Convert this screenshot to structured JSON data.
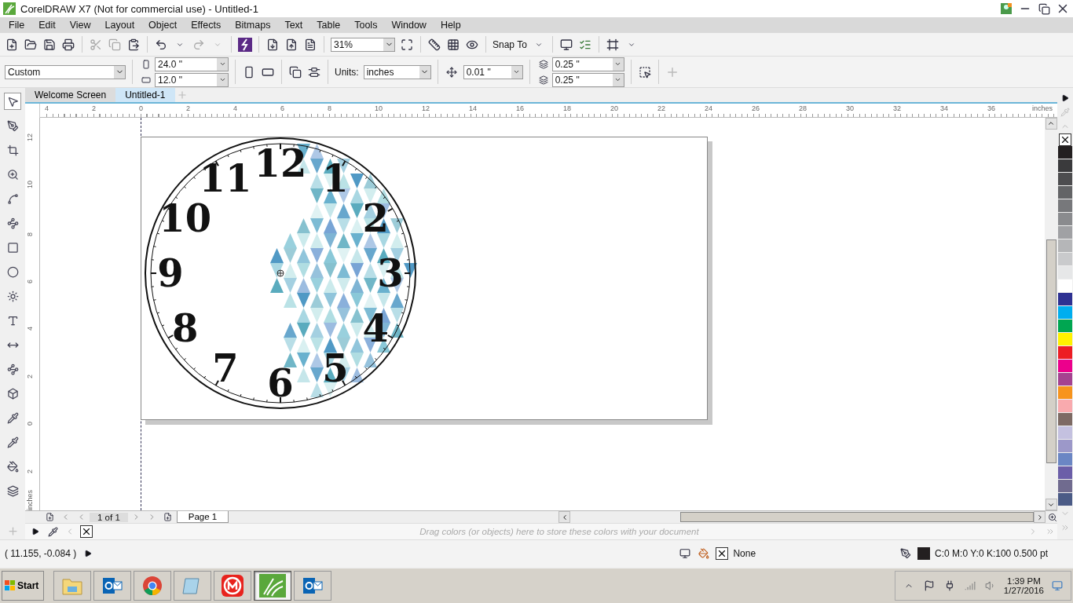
{
  "window": {
    "title": "CorelDRAW X7 (Not for commercial use) - Untitled-1"
  },
  "menu": [
    "File",
    "Edit",
    "View",
    "Layout",
    "Object",
    "Effects",
    "Bitmaps",
    "Text",
    "Table",
    "Tools",
    "Window",
    "Help"
  ],
  "toolbar": {
    "zoom": "31%",
    "snap_to": "Snap To"
  },
  "property_bar": {
    "preset": "Custom",
    "width": "24.0 \"",
    "height": "12.0 \"",
    "units_label": "Units:",
    "units": "inches",
    "nudge": "0.01 \"",
    "dup_x": "0.25 \"",
    "dup_y": "0.25 \""
  },
  "document_tabs": [
    {
      "label": "Welcome Screen",
      "selected": false
    },
    {
      "label": "Untitled-1",
      "selected": true
    }
  ],
  "ruler": {
    "h_ticks": [
      "4",
      "2",
      "0",
      "2",
      "4",
      "6",
      "8",
      "10",
      "12",
      "14",
      "16",
      "18",
      "20",
      "22",
      "24",
      "26",
      "28",
      "30",
      "32",
      "34",
      "36"
    ],
    "h_unit": "inches",
    "v_ticks": [
      "12",
      "10",
      "8",
      "6",
      "4",
      "2",
      "0",
      "2"
    ],
    "v_unit": "inches"
  },
  "clock": {
    "numerals": [
      "12",
      "11",
      "1",
      "10",
      "2",
      "9",
      "3",
      "8",
      "4",
      "7",
      "5",
      "6"
    ]
  },
  "page_nav": {
    "counter": "1 of 1",
    "page_tab": "Page 1"
  },
  "document_palette": {
    "hint": "Drag colors (or objects) here to store these colors with your document"
  },
  "palette": [
    {
      "color": "#231f20"
    },
    {
      "color": "#3a3a3c"
    },
    {
      "color": "#4d4d4f"
    },
    {
      "color": "#636466"
    },
    {
      "color": "#77787b"
    },
    {
      "color": "#8a8b8e"
    },
    {
      "color": "#a0a1a4"
    },
    {
      "color": "#b5b6b8"
    },
    {
      "color": "#c9cacc"
    },
    {
      "color": "#e6e7e8"
    },
    {
      "color": "#ffffff"
    },
    {
      "color": "#2e3192"
    },
    {
      "color": "#00aeef"
    },
    {
      "color": "#00a651"
    },
    {
      "color": "#fff200"
    },
    {
      "color": "#ed1c24"
    },
    {
      "color": "#ec008c"
    },
    {
      "color": "#a54290"
    },
    {
      "color": "#f7941d"
    },
    {
      "color": "#f9aaae"
    },
    {
      "color": "#7d6a64"
    },
    {
      "color": "#c4c1e0"
    },
    {
      "color": "#9c98c9"
    },
    {
      "color": "#6b86c4"
    },
    {
      "color": "#6b5ea8"
    },
    {
      "color": "#706b8f"
    },
    {
      "color": "#4b5b86"
    }
  ],
  "status": {
    "coords": "( 11.155, -0.084 )",
    "fill": "None",
    "outline": "C:0 M:0 Y:0 K:100  0.500 pt"
  },
  "taskbar": {
    "start": "Start",
    "apps": [
      {
        "kind": "folder",
        "selected": false
      },
      {
        "kind": "mail",
        "selected": false
      },
      {
        "kind": "browser",
        "selected": false
      },
      {
        "kind": "notepad",
        "selected": false
      },
      {
        "kind": "maker",
        "selected": false
      },
      {
        "kind": "corel",
        "selected": true
      },
      {
        "kind": "mail",
        "selected": false
      }
    ],
    "time": "1:39 PM",
    "date": "1/27/2016"
  }
}
